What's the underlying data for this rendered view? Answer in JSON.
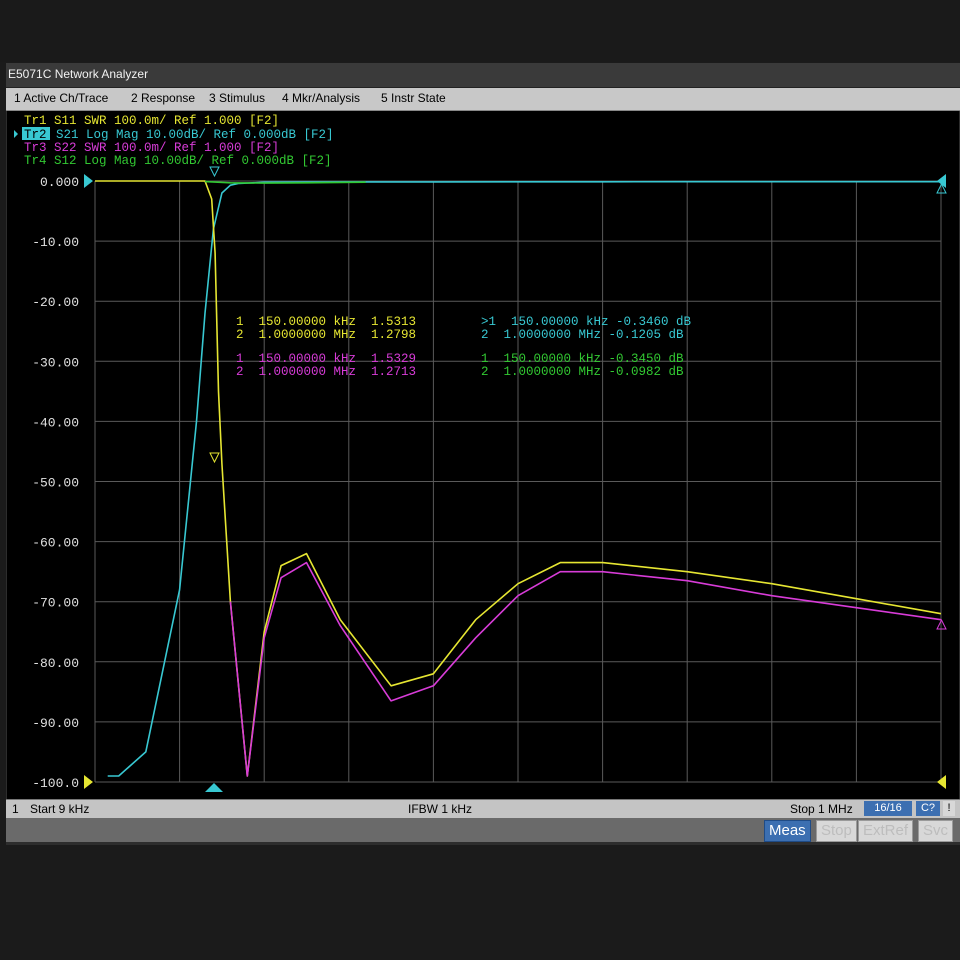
{
  "window": {
    "title": "E5071C Network Analyzer"
  },
  "menu": [
    {
      "label": "1 Active Ch/Trace"
    },
    {
      "label": "2 Response"
    },
    {
      "label": "3 Stimulus"
    },
    {
      "label": "4 Mkr/Analysis"
    },
    {
      "label": "5 Instr State"
    }
  ],
  "colors": {
    "tr1": "#e6e632",
    "tr2": "#38c8d2",
    "tr3": "#d83cd8",
    "tr4": "#32c832",
    "grid": "#5a5a5a",
    "axis_text": "#e0e0e0"
  },
  "traces": [
    {
      "id": "Tr1",
      "label": "Tr1 S11 SWR 100.0m/ Ref 1.000 [F2]"
    },
    {
      "id": "Tr2",
      "label": "S21 Log Mag 10.00dB/ Ref 0.000dB [F2]",
      "tag": "Tr2"
    },
    {
      "id": "Tr3",
      "label": "Tr3 S22 SWR 100.0m/ Ref 1.000 [F2]"
    },
    {
      "id": "Tr4",
      "label": "Tr4 S12 Log Mag 10.00dB/ Ref 0.000dB [F2]"
    }
  ],
  "marker_table": {
    "tr1": [
      "1  150.00000 kHz  1.5313",
      "2  1.0000000 MHz  1.2798"
    ],
    "tr2": [
      ">1  150.00000 kHz -0.3460 dB",
      "2  1.0000000 MHz -0.1205 dB"
    ],
    "tr3": [
      "1  150.00000 kHz  1.5329",
      "2  1.0000000 MHz  1.2713"
    ],
    "tr4": [
      "1  150.00000 kHz -0.3450 dB",
      "2  1.0000000 MHz -0.0982 dB"
    ]
  },
  "status": {
    "left_num": "1",
    "start": "Start 9 kHz",
    "ifbw": "IFBW 1 kHz",
    "stop": "Stop 1 MHz",
    "points": "16/16",
    "ch": "C?",
    "excl": "!"
  },
  "buttons": [
    {
      "label": "Meas",
      "active": true
    },
    {
      "label": "Stop",
      "active": false
    },
    {
      "label": "ExtRef",
      "active": false
    },
    {
      "label": "Svc",
      "active": false
    }
  ],
  "chart_data": {
    "type": "line",
    "xlim": [
      0,
      10
    ],
    "ylim": [
      -100,
      0
    ],
    "grid": true,
    "ytick_labels": [
      "0.000",
      "-10.00",
      "-20.00",
      "-30.00",
      "-40.00",
      "-50.00",
      "-60.00",
      "-70.00",
      "-80.00",
      "-90.00",
      "-100.0"
    ],
    "yticks": [
      0,
      -10,
      -20,
      -30,
      -40,
      -50,
      -60,
      -70,
      -80,
      -90,
      -100
    ],
    "series": [
      {
        "key": "tr2",
        "color": "#38c8d2",
        "x": [
          0.15,
          0.28,
          0.6,
          1.0,
          1.2,
          1.3,
          1.4,
          1.5,
          1.6,
          1.7,
          1.8,
          2.0,
          3.0,
          4.0,
          5.0,
          6.0,
          7.0,
          8.0,
          9.0,
          10.0
        ],
        "y": [
          -99,
          -99,
          -95,
          -68,
          -40,
          -22,
          -8,
          -2,
          -0.7,
          -0.4,
          -0.35,
          -0.2,
          -0.15,
          -0.15,
          -0.13,
          -0.13,
          -0.12,
          -0.12,
          -0.12,
          -0.12
        ]
      },
      {
        "key": "tr1",
        "color": "#e6e632",
        "x": [
          0,
          1.0,
          1.3,
          1.38,
          1.42,
          1.46,
          1.5,
          1.6,
          1.8,
          2.0,
          2.2,
          2.5,
          2.9,
          3.5,
          4.0,
          4.5,
          5.0,
          5.5,
          6.0,
          7.0,
          8.0,
          9.0,
          10.0
        ],
        "y": [
          0,
          0,
          0,
          -3,
          -12,
          -35,
          -47,
          -70,
          -99,
          -75,
          -64,
          -62,
          -73,
          -84,
          -82,
          -73,
          -67,
          -63.5,
          -63.5,
          -65,
          -67,
          -69.5,
          -72
        ]
      },
      {
        "key": "tr3",
        "color": "#d83cd8",
        "x": [
          1.6,
          1.8,
          2.0,
          2.2,
          2.5,
          2.9,
          3.5,
          4.0,
          4.5,
          5.0,
          5.5,
          6.0,
          7.0,
          8.0,
          9.0,
          10.0
        ],
        "y": [
          -70,
          -99,
          -76,
          -66,
          -63.5,
          -74,
          -86.5,
          -84,
          -76,
          -69,
          -65,
          -65,
          -66.5,
          -69,
          -71,
          -73
        ]
      },
      {
        "key": "tr4",
        "color": "#32c832",
        "x": [
          1.3,
          1.6,
          2.0,
          2.5,
          3.2
        ],
        "y": [
          -0.1,
          -0.3,
          -0.35,
          -0.3,
          -0.2
        ]
      }
    ]
  }
}
